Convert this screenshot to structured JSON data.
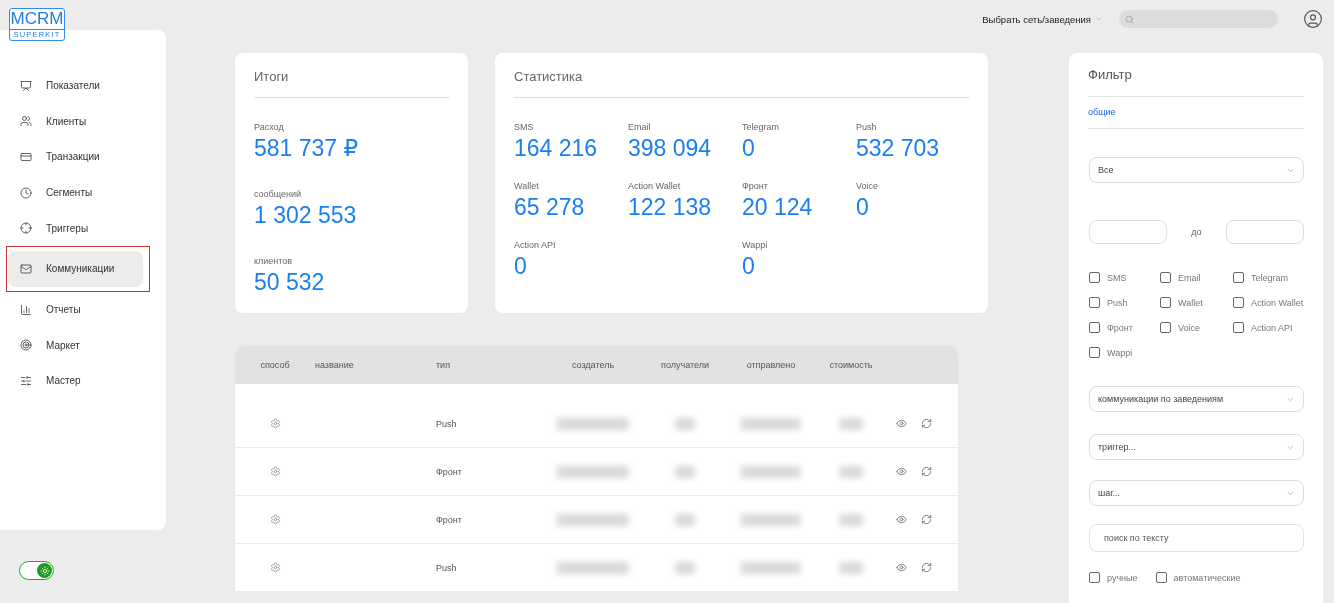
{
  "logo": {
    "title": "MCRM",
    "subtitle": "SUPERKIT"
  },
  "topbar": {
    "network_select": "Выбрать сеть/заведения"
  },
  "sidebar": {
    "items": [
      {
        "label": "Показатели",
        "selected": false
      },
      {
        "label": "Клиенты",
        "selected": false
      },
      {
        "label": "Транзакции",
        "selected": false
      },
      {
        "label": "Сегменты",
        "selected": false
      },
      {
        "label": "Триггеры",
        "selected": false
      },
      {
        "label": "Коммуникации",
        "selected": true
      },
      {
        "label": "Отчеты",
        "selected": false
      },
      {
        "label": "Маркет",
        "selected": false
      },
      {
        "label": "Мастер",
        "selected": false
      }
    ],
    "theme_toggle": {
      "on": true
    }
  },
  "totals": {
    "title": "Итоги",
    "items": [
      {
        "label": "Расход",
        "value": "581 737 ₽"
      },
      {
        "label": "сообщений",
        "value": "1 302 553"
      },
      {
        "label": "клиентов",
        "value": "50 532"
      }
    ]
  },
  "statistics": {
    "title": "Статистика",
    "rows": [
      [
        {
          "label": "SMS",
          "value": "164 216"
        },
        {
          "label": "Email",
          "value": "398 094"
        },
        {
          "label": "Telegram",
          "value": "0"
        },
        {
          "label": "Push",
          "value": "532 703"
        }
      ],
      [
        {
          "label": "Wallet",
          "value": "65 278"
        },
        {
          "label": "Action Wallet",
          "value": "122 138"
        },
        {
          "label": "Фронт",
          "value": "20 124"
        },
        {
          "label": "Voice",
          "value": "0"
        }
      ],
      [
        {
          "label": "Action API",
          "value": "0"
        },
        "",
        {
          "label": "Wappi",
          "value": "0"
        },
        ""
      ]
    ]
  },
  "table": {
    "columns": [
      "способ",
      "название",
      "тип",
      "создатель",
      "получатели",
      "отправлено",
      "стоимость"
    ],
    "rows": [
      {
        "type": "Push"
      },
      {
        "type": "Фронт"
      },
      {
        "type": "Фронт"
      },
      {
        "type": "Push"
      }
    ]
  },
  "filter": {
    "title": "Фильтр",
    "tab": "общие",
    "period_select": "Все",
    "range_separator": "до",
    "channels": [
      {
        "label": "SMS",
        "checked": false
      },
      {
        "label": "Email",
        "checked": false
      },
      {
        "label": "Telegram",
        "checked": false
      },
      {
        "label": "Push",
        "checked": false
      },
      {
        "label": "Wallet",
        "checked": false
      },
      {
        "label": "Action Wallet",
        "checked": false
      },
      {
        "label": "Фронт",
        "checked": false
      },
      {
        "label": "Voice",
        "checked": false
      },
      {
        "label": "Action API",
        "checked": false
      },
      {
        "label": "Wappi",
        "checked": false
      }
    ],
    "venue_select": "коммуникации по заведениям",
    "trigger_select": "триггер...",
    "step_select": "шаг...",
    "search": {
      "placeholder": "поиск по тексту"
    },
    "modes": [
      {
        "label": "ручные",
        "checked": false
      },
      {
        "label": "автоматические",
        "checked": false
      }
    ]
  }
}
